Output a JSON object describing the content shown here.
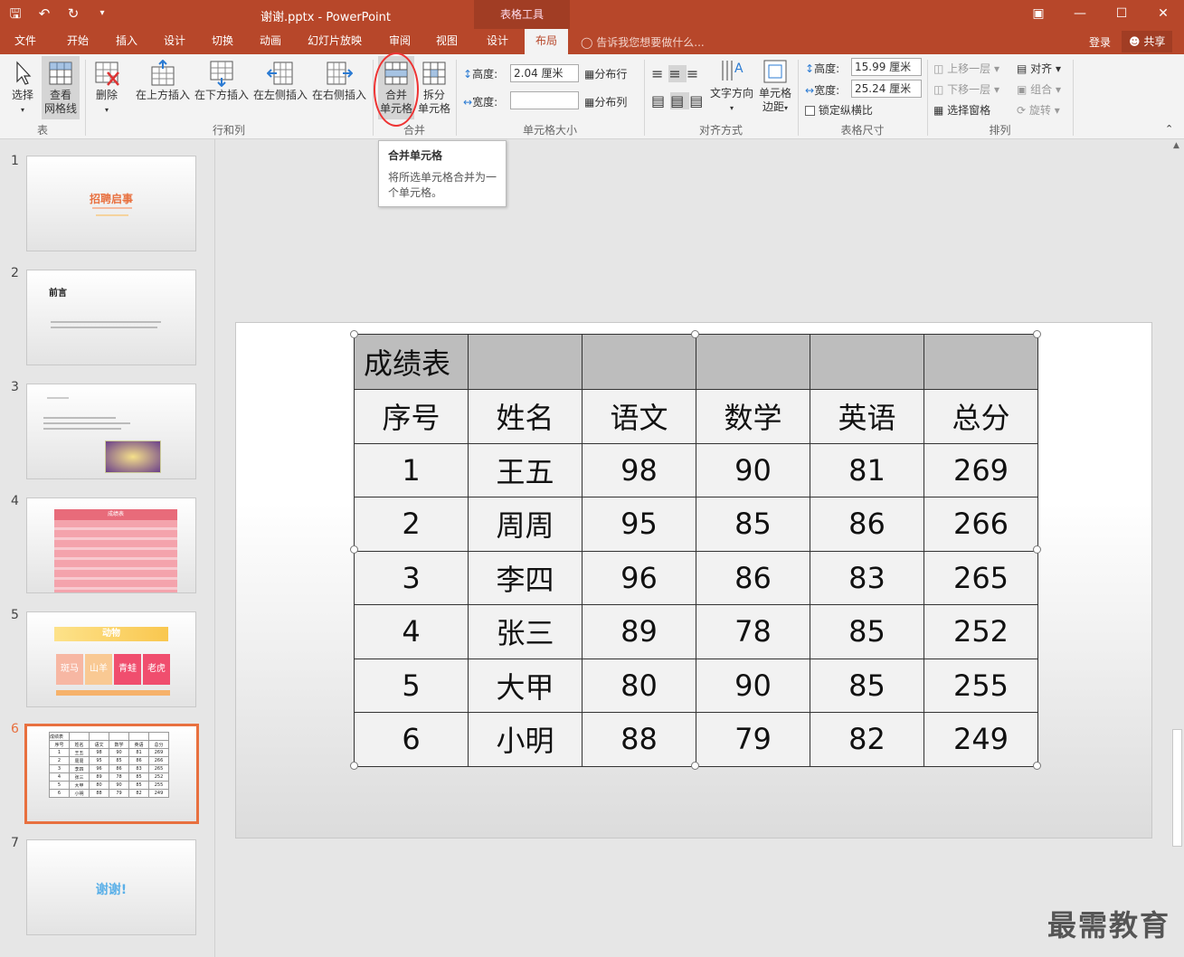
{
  "titlebar": {
    "doc_title": "谢谢.pptx - PowerPoint",
    "context_tab": "表格工具",
    "qat_icons": [
      "save-icon",
      "undo-icon",
      "redo-icon",
      "customize-icon"
    ]
  },
  "tabs": [
    "文件",
    "开始",
    "插入",
    "设计",
    "切换",
    "动画",
    "幻灯片放映",
    "审阅",
    "视图",
    "设计",
    "布局"
  ],
  "active_tab": "布局",
  "tell_me": "告诉我您想要做什么...",
  "login": "登录",
  "share": "共享",
  "ribbon": {
    "select": "选择",
    "view_grid_1": "查看",
    "view_grid_2": "网格线",
    "delete": "删除",
    "insert_above": "在上方插入",
    "insert_below": "在下方插入",
    "insert_left": "在左侧插入",
    "insert_right": "在右侧插入",
    "merge_1": "合并",
    "merge_2": "单元格",
    "split_1": "拆分",
    "split_2": "单元格",
    "height_label": "高度:",
    "height_value": "2.04 厘米",
    "width_label": "宽度:",
    "width_value": "",
    "distribute_rows": "分布行",
    "distribute_cols": "分布列",
    "text_direction": "文字方向",
    "cell_margin_1": "单元格",
    "cell_margin_2": "边距",
    "table_height_label": "高度:",
    "table_height_value": "15.99 厘米",
    "table_width_label": "宽度:",
    "table_width_value": "25.24 厘米",
    "lock_ratio": "锁定纵横比",
    "bring_forward": "上移一层",
    "send_backward": "下移一层",
    "selection_pane": "选择窗格",
    "align": "对齐",
    "group": "组合",
    "rotate": "旋转",
    "groups": [
      "表",
      "行和列",
      "合并",
      "单元格大小",
      "对齐方式",
      "表格尺寸",
      "排列"
    ]
  },
  "tooltip": {
    "title": "合并单元格",
    "desc": "将所选单元格合并为一个单元格。"
  },
  "thumbnails": {
    "numbers": [
      "1",
      "2",
      "3",
      "4",
      "5",
      "6",
      "7"
    ],
    "s1_title": "招聘启事",
    "s2_title": "前言",
    "s4_title": "成绩表",
    "s5_title": "动物",
    "s5_cells": [
      "斑马",
      "山羊",
      "青蛙",
      "老虎"
    ],
    "s6_title": "成绩表",
    "s7_title": "谢谢!"
  },
  "table": {
    "title": "成绩表",
    "headers": [
      "序号",
      "姓名",
      "语文",
      "数学",
      "英语",
      "总分"
    ],
    "rows": [
      [
        "1",
        "王五",
        "98",
        "90",
        "81",
        "269"
      ],
      [
        "2",
        "周周",
        "95",
        "85",
        "86",
        "266"
      ],
      [
        "3",
        "李四",
        "96",
        "86",
        "83",
        "265"
      ],
      [
        "4",
        "张三",
        "89",
        "78",
        "85",
        "252"
      ],
      [
        "5",
        "大甲",
        "80",
        "90",
        "85",
        "255"
      ],
      [
        "6",
        "小明",
        "88",
        "79",
        "82",
        "249"
      ]
    ]
  },
  "watermark": "最需教育"
}
